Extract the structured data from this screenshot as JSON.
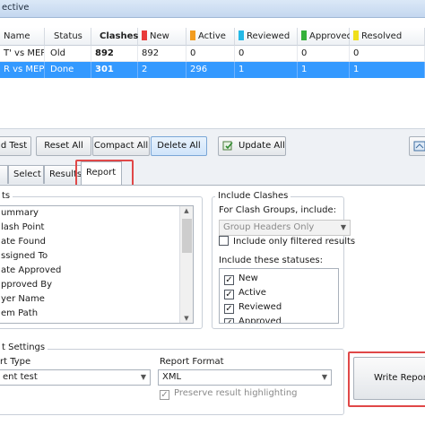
{
  "window": {
    "title": "ective"
  },
  "grid": {
    "columns": [
      {
        "label": "Name",
        "swatch": null,
        "bold": false
      },
      {
        "label": "Status",
        "swatch": null,
        "bold": false
      },
      {
        "label": "Clashes",
        "swatch": null,
        "bold": true
      },
      {
        "label": "New",
        "swatch": "#e83a3a",
        "bold": false
      },
      {
        "label": "Active",
        "swatch": "#f29c1f",
        "bold": false
      },
      {
        "label": "Reviewed",
        "swatch": "#25b9e6",
        "bold": false
      },
      {
        "label": "Approved",
        "swatch": "#35b13a",
        "bold": false
      },
      {
        "label": "Resolved",
        "swatch": "#f0df1a",
        "bold": false
      }
    ],
    "rows": [
      [
        "T' vs MEP",
        "Old",
        "892",
        "892",
        "0",
        "0",
        "0",
        "0"
      ],
      [
        "R vs MEP",
        "Done",
        "301",
        "2",
        "296",
        "1",
        "1",
        "1"
      ]
    ]
  },
  "toolbar": {
    "test_label": "d Test",
    "reset_all": "Reset All",
    "compact_all": "Compact All",
    "delete_all": "Delete All",
    "update_all": "Update All"
  },
  "tabs": [
    "Select",
    "Results",
    "Report"
  ],
  "contents": {
    "label": "ts",
    "items": [
      "ummary",
      "lash Point",
      "ate Found",
      "ssigned To",
      "ate Approved",
      "pproved By",
      "yer Name",
      "em Path"
    ]
  },
  "include_clashes": {
    "label": "Include Clashes",
    "groups_label": "For Clash Groups, include:",
    "groups_value": "Group Headers Only",
    "filtered_label": "Include only filtered results",
    "statuses_label": "Include these statuses:",
    "statuses": [
      {
        "label": "New",
        "checked": true
      },
      {
        "label": "Active",
        "checked": true
      },
      {
        "label": "Reviewed",
        "checked": true
      },
      {
        "label": "Approved",
        "checked": true
      }
    ]
  },
  "output_settings": {
    "label": "t Settings",
    "report_type_label": "rt Type",
    "report_type_value": "ent test",
    "report_format_label": "Report Format",
    "report_format_value": "XML",
    "preserve_label": "Preserve result highlighting",
    "write_report": "Write Report"
  }
}
